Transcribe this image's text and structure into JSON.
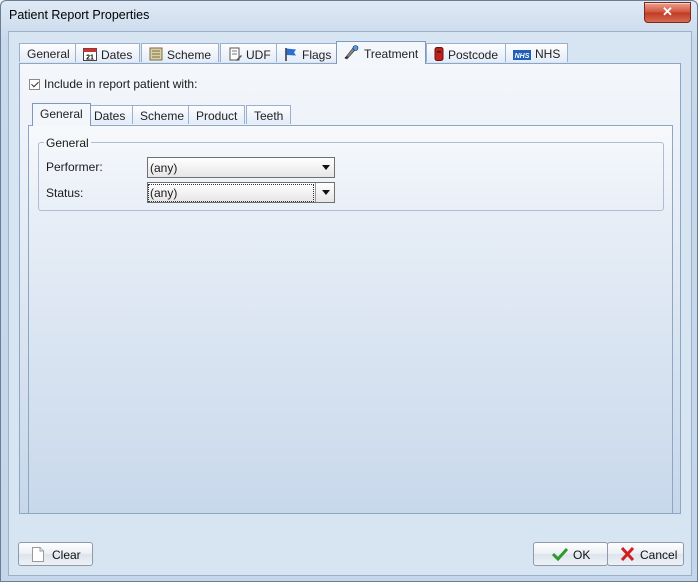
{
  "window": {
    "title": "Patient Report Properties",
    "close_glyph": "✕"
  },
  "tabs": [
    {
      "label": "General",
      "icon": ""
    },
    {
      "label": "Dates",
      "icon": "calendar-icon",
      "icon_text": "21"
    },
    {
      "label": "Scheme",
      "icon": "scheme-icon"
    },
    {
      "label": "UDF",
      "icon": "udf-icon"
    },
    {
      "label": "Flags",
      "icon": "flag-icon"
    },
    {
      "label": "Treatment",
      "icon": "treatment-icon",
      "active": true
    },
    {
      "label": "Postcode",
      "icon": "postcode-icon"
    },
    {
      "label": "NHS",
      "icon": "nhs-logo-icon",
      "icon_text": "NHS"
    }
  ],
  "include_checkbox": {
    "label": "Include in report patient with:",
    "checked": true
  },
  "subtabs": [
    {
      "label": "General",
      "active": true
    },
    {
      "label": "Dates"
    },
    {
      "label": "Scheme"
    },
    {
      "label": "Product"
    },
    {
      "label": "Teeth"
    }
  ],
  "group": {
    "title": "General",
    "performer": {
      "label": "Performer:",
      "value": "(any)"
    },
    "status": {
      "label": "Status:",
      "value": "(any)"
    }
  },
  "buttons": {
    "clear": "Clear",
    "ok": "OK",
    "cancel": "Cancel"
  },
  "colors": {
    "accent": "#3a6ea5",
    "ok_green": "#2e9a2e",
    "cancel_red": "#d02020"
  }
}
